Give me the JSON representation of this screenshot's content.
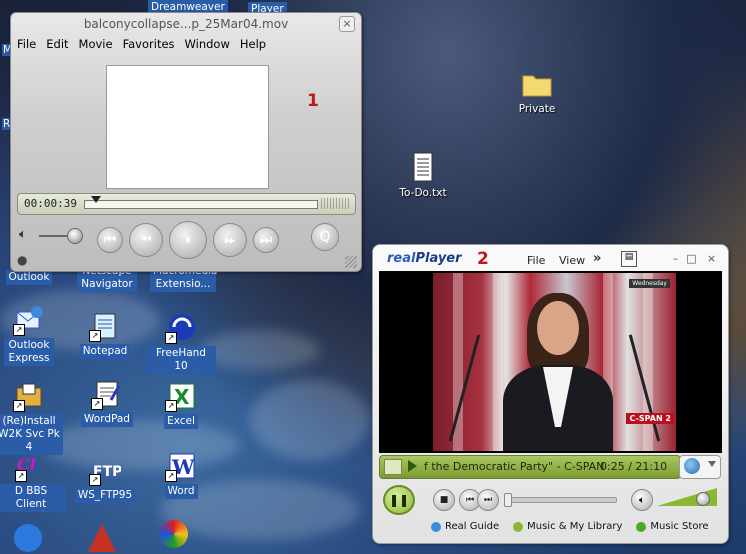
{
  "desktop": {
    "partial_labels": {
      "top_dreamweaver": "Dreamweaver",
      "top_player": "Player",
      "left_m": "M",
      "left_r": "R"
    },
    "icons": [
      {
        "id": "private",
        "label": "Private",
        "icon": "folder-icon"
      },
      {
        "id": "todo",
        "label": "To-Do.txt",
        "icon": "text-file-icon"
      },
      {
        "id": "outlook",
        "label": "Outlook",
        "icon": "outlook-icon"
      },
      {
        "id": "netscape",
        "label": "Netscape Navigator",
        "icon": "netscape-icon"
      },
      {
        "id": "macromedia",
        "label": "Macromedia Extensio...",
        "icon": "macromedia-icon"
      },
      {
        "id": "outlook-express",
        "label": "Outlook Express",
        "icon": "outlook-express-icon"
      },
      {
        "id": "notepad",
        "label": "Notepad",
        "icon": "notepad-icon"
      },
      {
        "id": "freehand",
        "label": "FreeHand 10",
        "icon": "freehand-icon"
      },
      {
        "id": "reinstall",
        "label": "(Re)Install W2K Svc Pk 4",
        "icon": "installer-icon"
      },
      {
        "id": "wordpad",
        "label": "WordPad",
        "icon": "wordpad-icon"
      },
      {
        "id": "excel",
        "label": "Excel",
        "icon": "excel-icon"
      },
      {
        "id": "bbs",
        "label": "D BBS Client",
        "icon": "bbs-client-icon"
      },
      {
        "id": "wsftp",
        "label": "WS_FTP95",
        "icon": "ftp-icon"
      },
      {
        "id": "word",
        "label": "Word",
        "icon": "word-icon"
      }
    ]
  },
  "quicktime": {
    "title": "balconycollapse...p_25Mar04.mov",
    "close": "×",
    "menu": [
      "File",
      "Edit",
      "Movie",
      "Favorites",
      "Window",
      "Help"
    ],
    "marker": "1",
    "time": "00:00:39",
    "progress": 0.03
  },
  "realplayer": {
    "logo_prefix": "real",
    "logo_suffix": "Player",
    "marker": "2",
    "menu": [
      "File",
      "View"
    ],
    "more": "»",
    "channel_badge": "C-SPAN 2",
    "channel_corner": "Wednesday",
    "clip_title": "f the Democratic Party\" - C-SPAN",
    "clip_time": "0:25 / 21:10",
    "seek_fraction": 0.0,
    "volume_fraction": 0.82,
    "links": [
      "Real Guide",
      "Music & My Library",
      "Music Store"
    ]
  }
}
